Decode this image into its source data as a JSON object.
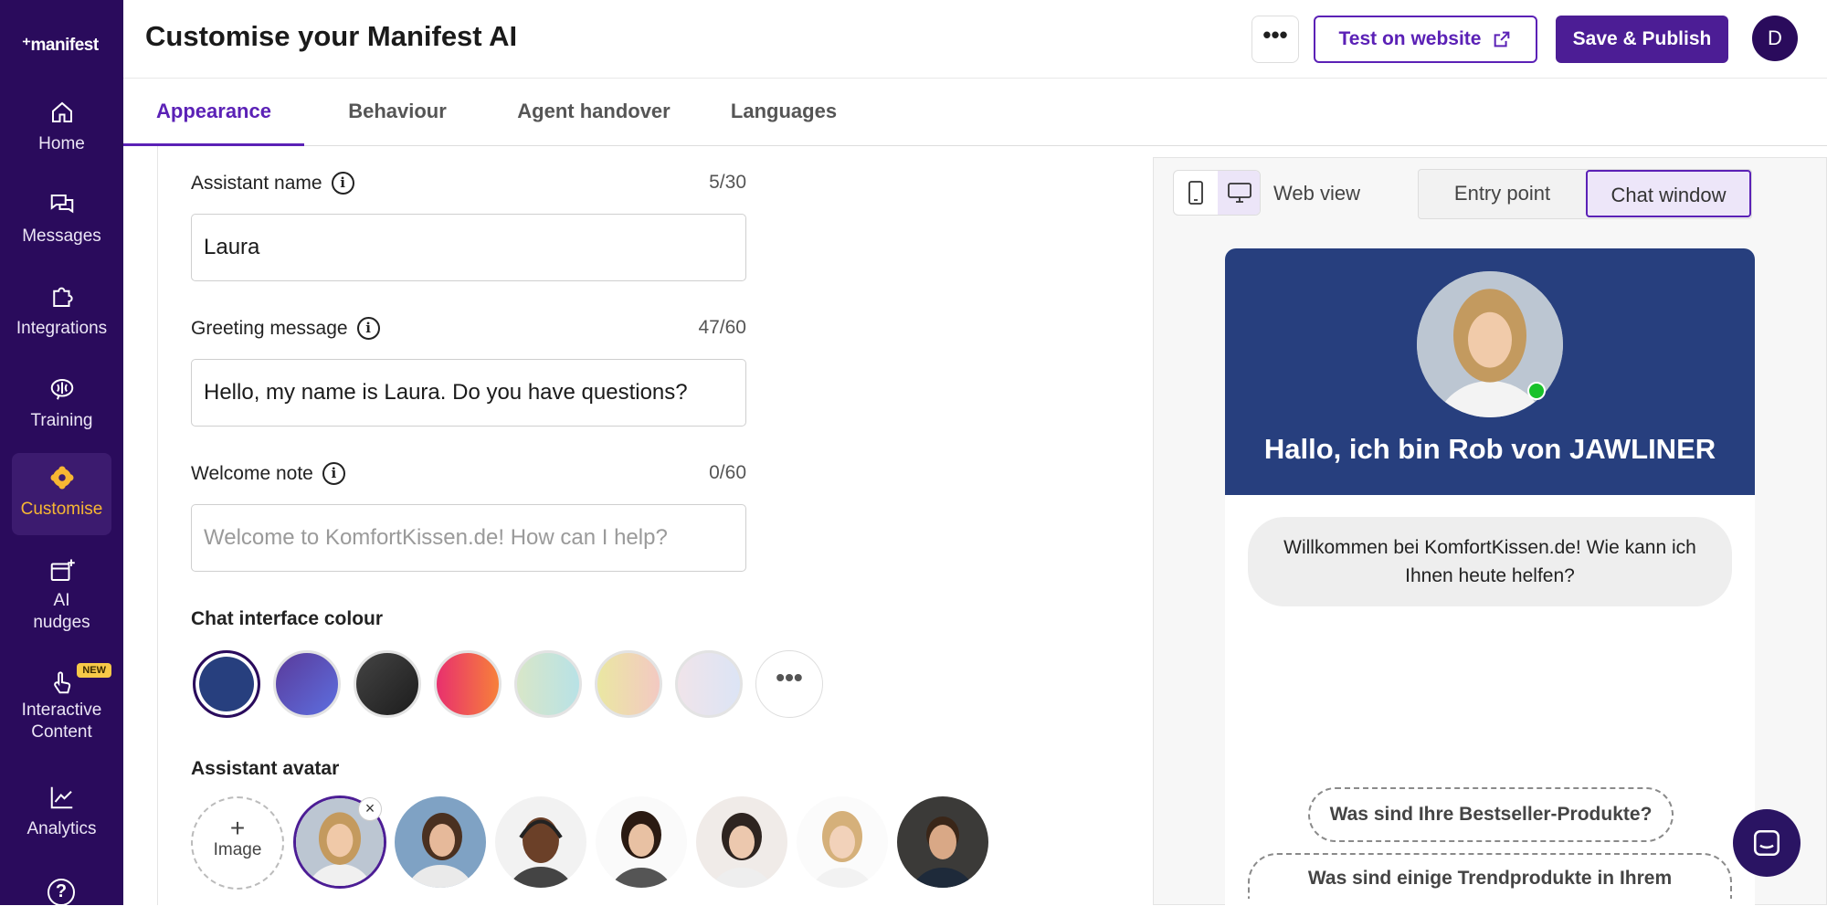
{
  "sidebar": {
    "logo": "⁺manifest",
    "items": [
      {
        "label": "Home",
        "icon": "home-icon"
      },
      {
        "label": "Messages",
        "icon": "messages-icon"
      },
      {
        "label": "Integrations",
        "icon": "puzzle-icon"
      },
      {
        "label": "Training",
        "icon": "brain-icon"
      },
      {
        "label": "Customise",
        "icon": "gear-icon",
        "active": true
      },
      {
        "label": "AI\nnudges",
        "label_line1": "AI",
        "label_line2": "nudges",
        "icon": "nudge-icon"
      },
      {
        "label": "Interactive Content",
        "label_line1": "Interactive",
        "label_line2": "Content",
        "icon": "tap-icon",
        "badge": "NEW"
      },
      {
        "label": "Analytics",
        "icon": "analytics-icon"
      }
    ],
    "help": "?"
  },
  "header": {
    "title": "Customise your Manifest AI",
    "more": "•••",
    "test_label": "Test on website",
    "save_label": "Save & Publish",
    "user_initial": "D"
  },
  "tabs": [
    "Appearance",
    "Behaviour",
    "Agent handover",
    "Languages"
  ],
  "form": {
    "assistant_name": {
      "label": "Assistant name",
      "counter": "5/30",
      "value": "Laura"
    },
    "greeting": {
      "label": "Greeting message",
      "counter": "47/60",
      "value": "Hello, my name is Laura. Do you have questions?"
    },
    "welcome": {
      "label": "Welcome note",
      "counter": "0/60",
      "placeholder": "Welcome to KomfortKissen.de! How can I help?"
    },
    "colour_title": "Chat interface colour",
    "colours": [
      "#273f7e",
      "#6a4fc1",
      "#2b2b2b",
      "#f0456a",
      "#c9e6da",
      "#f1dcb0",
      "#ece6f2"
    ],
    "avatar_title": "Assistant avatar",
    "add_image": "Image"
  },
  "preview": {
    "web_view": "Web view",
    "entry_point": "Entry point",
    "chat_window": "Chat window",
    "chat_title": "Hallo, ich bin Rob von JAWLINER",
    "welcome_bubble": "Willkommen bei KomfortKissen.de! Wie kann ich Ihnen heute helfen?",
    "suggestions": [
      "Was sind Ihre Bestseller-Produkte?",
      "Was sind einige Trendprodukte in Ihrem"
    ]
  },
  "colors": {
    "sidebar": "#2a0b5c",
    "accent": "#5b21b6",
    "chat_header": "#273f7e",
    "active_nav_text": "#f7b733"
  }
}
